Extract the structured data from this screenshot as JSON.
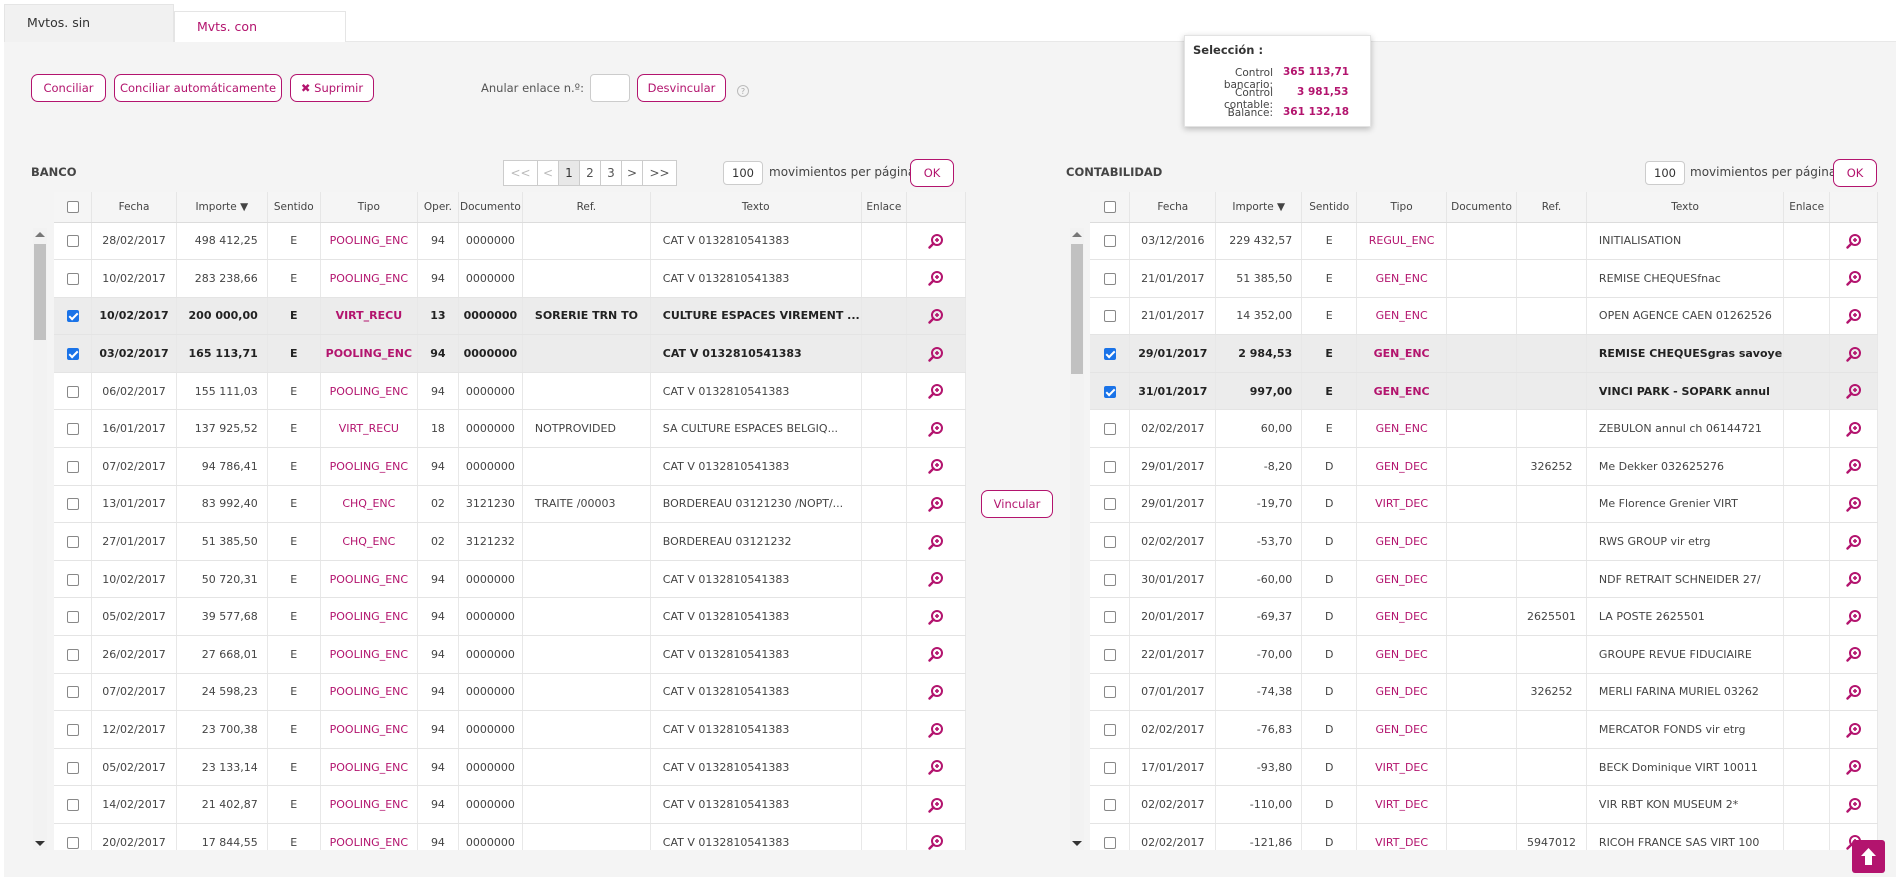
{
  "tabs": {
    "unreconciled": "Mvtos. sin conciliación",
    "reconciled": "Mvts. con conciliación"
  },
  "toolbar": {
    "conciliar": "Conciliar",
    "auto": "Conciliar automáticamente",
    "suprimir": "Suprimir",
    "anular_label": "Anular enlace n.º:",
    "anular_value": "",
    "desvincular": "Desvincular",
    "help": "?"
  },
  "selection": {
    "title": "Selección :",
    "bank_label": "Control bancario:",
    "bank_value": "365 113,71",
    "acc_label": "Control contable:",
    "acc_value": "3 981,53",
    "bal_label": "Balance:",
    "bal_value": "361 132,18"
  },
  "vincular": "Vincular",
  "bank": {
    "title": "BANCO",
    "pager": [
      "<<",
      "<",
      "1",
      "2",
      "3",
      ">",
      ">>"
    ],
    "per_page": "100",
    "per_page_label": "movimientos per página",
    "ok": "OK",
    "headers": [
      "Fecha",
      "Importe ▼",
      "Sentido",
      "Tipo",
      "Oper.",
      "Documento",
      "Ref.",
      "Texto",
      "Enlace"
    ],
    "rows": [
      {
        "sel": false,
        "fecha": "28/02/2017",
        "importe": "498 412,25",
        "sentido": "E",
        "tipo": "POOLING_ENC",
        "oper": "94",
        "doc": "0000000",
        "ref": "",
        "texto": "CAT V 0132810541383",
        "enlace": ""
      },
      {
        "sel": false,
        "fecha": "10/02/2017",
        "importe": "283 238,66",
        "sentido": "E",
        "tipo": "POOLING_ENC",
        "oper": "94",
        "doc": "0000000",
        "ref": "",
        "texto": "CAT V 0132810541383",
        "enlace": ""
      },
      {
        "sel": true,
        "fecha": "10/02/2017",
        "importe": "200 000,00",
        "sentido": "E",
        "tipo": "VIRT_RECU",
        "oper": "13",
        "doc": "0000000",
        "ref": "SORERIE TRN TO",
        "texto": "CULTURE ESPACES VIREMENT ...",
        "enlace": ""
      },
      {
        "sel": true,
        "fecha": "03/02/2017",
        "importe": "165 113,71",
        "sentido": "E",
        "tipo": "POOLING_ENC",
        "oper": "94",
        "doc": "0000000",
        "ref": "",
        "texto": "CAT V 0132810541383",
        "enlace": ""
      },
      {
        "sel": false,
        "fecha": "06/02/2017",
        "importe": "155 111,03",
        "sentido": "E",
        "tipo": "POOLING_ENC",
        "oper": "94",
        "doc": "0000000",
        "ref": "",
        "texto": "CAT V 0132810541383",
        "enlace": ""
      },
      {
        "sel": false,
        "fecha": "16/01/2017",
        "importe": "137 925,52",
        "sentido": "E",
        "tipo": "VIRT_RECU",
        "oper": "18",
        "doc": "0000000",
        "ref": "NOTPROVIDED",
        "texto": "SA CULTURE ESPACES BELGIQ...",
        "enlace": ""
      },
      {
        "sel": false,
        "fecha": "07/02/2017",
        "importe": "94 786,41",
        "sentido": "E",
        "tipo": "POOLING_ENC",
        "oper": "94",
        "doc": "0000000",
        "ref": "",
        "texto": "CAT V 0132810541383",
        "enlace": ""
      },
      {
        "sel": false,
        "fecha": "13/01/2017",
        "importe": "83 992,40",
        "sentido": "E",
        "tipo": "CHQ_ENC",
        "oper": "02",
        "doc": "3121230",
        "ref": "TRAITE /00003",
        "texto": "BORDEREAU 03121230 /NOPT/...",
        "enlace": ""
      },
      {
        "sel": false,
        "fecha": "27/01/2017",
        "importe": "51 385,50",
        "sentido": "E",
        "tipo": "CHQ_ENC",
        "oper": "02",
        "doc": "3121232",
        "ref": "",
        "texto": "BORDEREAU 03121232",
        "enlace": ""
      },
      {
        "sel": false,
        "fecha": "10/02/2017",
        "importe": "50 720,31",
        "sentido": "E",
        "tipo": "POOLING_ENC",
        "oper": "94",
        "doc": "0000000",
        "ref": "",
        "texto": "CAT V 0132810541383",
        "enlace": ""
      },
      {
        "sel": false,
        "fecha": "05/02/2017",
        "importe": "39 577,68",
        "sentido": "E",
        "tipo": "POOLING_ENC",
        "oper": "94",
        "doc": "0000000",
        "ref": "",
        "texto": "CAT V 0132810541383",
        "enlace": ""
      },
      {
        "sel": false,
        "fecha": "26/02/2017",
        "importe": "27 668,01",
        "sentido": "E",
        "tipo": "POOLING_ENC",
        "oper": "94",
        "doc": "0000000",
        "ref": "",
        "texto": "CAT V 0132810541383",
        "enlace": ""
      },
      {
        "sel": false,
        "fecha": "07/02/2017",
        "importe": "24 598,23",
        "sentido": "E",
        "tipo": "POOLING_ENC",
        "oper": "94",
        "doc": "0000000",
        "ref": "",
        "texto": "CAT V 0132810541383",
        "enlace": ""
      },
      {
        "sel": false,
        "fecha": "12/02/2017",
        "importe": "23 700,38",
        "sentido": "E",
        "tipo": "POOLING_ENC",
        "oper": "94",
        "doc": "0000000",
        "ref": "",
        "texto": "CAT V 0132810541383",
        "enlace": ""
      },
      {
        "sel": false,
        "fecha": "05/02/2017",
        "importe": "23 133,14",
        "sentido": "E",
        "tipo": "POOLING_ENC",
        "oper": "94",
        "doc": "0000000",
        "ref": "",
        "texto": "CAT V 0132810541383",
        "enlace": ""
      },
      {
        "sel": false,
        "fecha": "14/02/2017",
        "importe": "21 402,87",
        "sentido": "E",
        "tipo": "POOLING_ENC",
        "oper": "94",
        "doc": "0000000",
        "ref": "",
        "texto": "CAT V 0132810541383",
        "enlace": ""
      },
      {
        "sel": false,
        "fecha": "20/02/2017",
        "importe": "17 844,55",
        "sentido": "E",
        "tipo": "POOLING_ENC",
        "oper": "94",
        "doc": "0000000",
        "ref": "",
        "texto": "CAT V 0132810541383",
        "enlace": ""
      }
    ]
  },
  "acc": {
    "title": "CONTABILIDAD",
    "per_page": "100",
    "per_page_label": "movimientos per página",
    "ok": "OK",
    "headers": [
      "Fecha",
      "Importe ▼",
      "Sentido",
      "Tipo",
      "Documento",
      "Ref.",
      "Texto",
      "Enlace"
    ],
    "rows": [
      {
        "sel": false,
        "fecha": "03/12/2016",
        "importe": "229 432,57",
        "sentido": "E",
        "tipo": "REGUL_ENC",
        "doc": "",
        "ref": "",
        "texto": "INITIALISATION",
        "enlace": ""
      },
      {
        "sel": false,
        "fecha": "21/01/2017",
        "importe": "51 385,50",
        "sentido": "E",
        "tipo": "GEN_ENC",
        "doc": "",
        "ref": "",
        "texto": "REMISE CHEQUESfnac",
        "enlace": ""
      },
      {
        "sel": false,
        "fecha": "21/01/2017",
        "importe": "14 352,00",
        "sentido": "E",
        "tipo": "GEN_ENC",
        "doc": "",
        "ref": "",
        "texto": "OPEN AGENCE CAEN 01262526",
        "enlace": ""
      },
      {
        "sel": true,
        "fecha": "29/01/2017",
        "importe": "2 984,53",
        "sentido": "E",
        "tipo": "GEN_ENC",
        "doc": "",
        "ref": "",
        "texto": "REMISE CHEQUESgras savoye",
        "enlace": ""
      },
      {
        "sel": true,
        "fecha": "31/01/2017",
        "importe": "997,00",
        "sentido": "E",
        "tipo": "GEN_ENC",
        "doc": "",
        "ref": "",
        "texto": "VINCI PARK - SOPARK annul",
        "enlace": ""
      },
      {
        "sel": false,
        "fecha": "02/02/2017",
        "importe": "60,00",
        "sentido": "E",
        "tipo": "GEN_ENC",
        "doc": "",
        "ref": "",
        "texto": "ZEBULON annul ch 06144721",
        "enlace": ""
      },
      {
        "sel": false,
        "fecha": "29/01/2017",
        "importe": "-8,20",
        "sentido": "D",
        "tipo": "GEN_DEC",
        "doc": "",
        "ref": "326252",
        "texto": "Me Dekker 032625276",
        "enlace": ""
      },
      {
        "sel": false,
        "fecha": "29/01/2017",
        "importe": "-19,70",
        "sentido": "D",
        "tipo": "VIRT_DEC",
        "doc": "",
        "ref": "",
        "texto": "Me Florence Grenier VIRT",
        "enlace": ""
      },
      {
        "sel": false,
        "fecha": "02/02/2017",
        "importe": "-53,70",
        "sentido": "D",
        "tipo": "GEN_DEC",
        "doc": "",
        "ref": "",
        "texto": "RWS GROUP vir etrg",
        "enlace": ""
      },
      {
        "sel": false,
        "fecha": "30/01/2017",
        "importe": "-60,00",
        "sentido": "D",
        "tipo": "GEN_DEC",
        "doc": "",
        "ref": "",
        "texto": "NDF RETRAIT SCHNEIDER 27/",
        "enlace": ""
      },
      {
        "sel": false,
        "fecha": "20/01/2017",
        "importe": "-69,37",
        "sentido": "D",
        "tipo": "GEN_DEC",
        "doc": "",
        "ref": "2625501",
        "texto": "LA POSTE 2625501",
        "enlace": ""
      },
      {
        "sel": false,
        "fecha": "22/01/2017",
        "importe": "-70,00",
        "sentido": "D",
        "tipo": "GEN_DEC",
        "doc": "",
        "ref": "",
        "texto": "GROUPE REVUE FIDUCIAIRE",
        "enlace": ""
      },
      {
        "sel": false,
        "fecha": "07/01/2017",
        "importe": "-74,38",
        "sentido": "D",
        "tipo": "GEN_DEC",
        "doc": "",
        "ref": "326252",
        "texto": "MERLI FARINA MURIEL 03262",
        "enlace": ""
      },
      {
        "sel": false,
        "fecha": "02/02/2017",
        "importe": "-76,83",
        "sentido": "D",
        "tipo": "GEN_DEC",
        "doc": "",
        "ref": "",
        "texto": "MERCATOR FONDS vir etrg",
        "enlace": ""
      },
      {
        "sel": false,
        "fecha": "17/01/2017",
        "importe": "-93,80",
        "sentido": "D",
        "tipo": "VIRT_DEC",
        "doc": "",
        "ref": "",
        "texto": "BECK Dominique VIRT 10011",
        "enlace": ""
      },
      {
        "sel": false,
        "fecha": "02/02/2017",
        "importe": "-110,00",
        "sentido": "D",
        "tipo": "VIRT_DEC",
        "doc": "",
        "ref": "",
        "texto": "VIR RBT KON MUSEUM 2*",
        "enlace": ""
      },
      {
        "sel": false,
        "fecha": "02/02/2017",
        "importe": "-121,86",
        "sentido": "D",
        "tipo": "VIRT_DEC",
        "doc": "",
        "ref": "5947012",
        "texto": "RICOH FRANCE SAS VIRT 100",
        "enlace": ""
      }
    ]
  },
  "colors": {
    "accent": "#b3146e",
    "check": "#1a73e8"
  },
  "icons": {
    "zoom": "zoom-icon",
    "delete": "delete-icon",
    "help": "help-icon",
    "to_top": "arrow-up-icon"
  }
}
